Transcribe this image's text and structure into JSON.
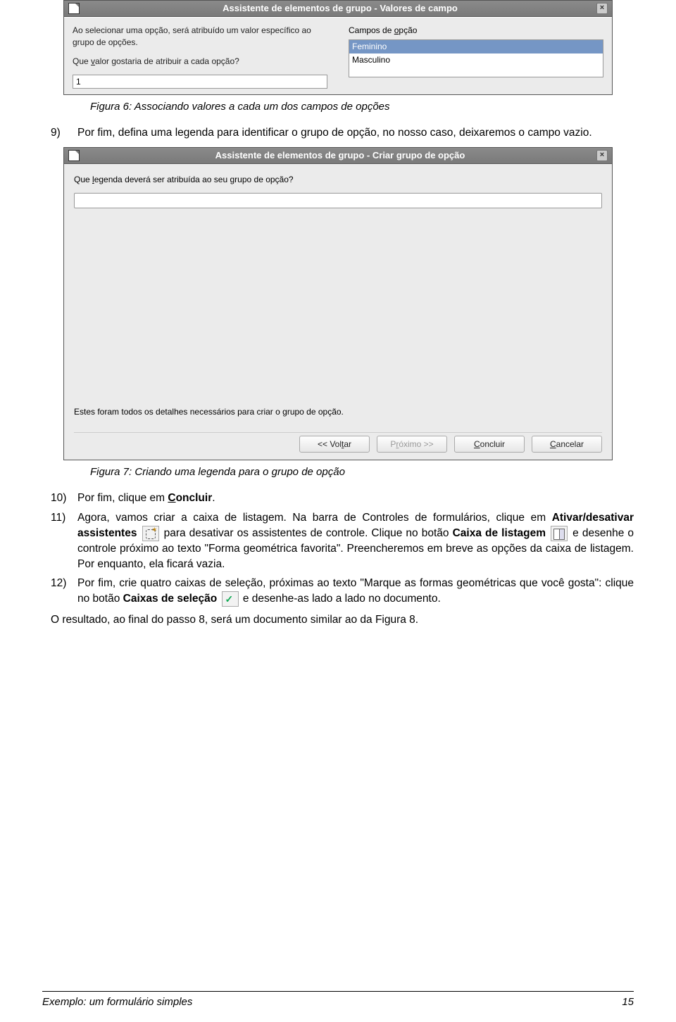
{
  "dialog1": {
    "title": "Assistente de elementos de grupo - Valores de campo",
    "left_p1": "Ao selecionar uma opção, será atribuído um valor específico ao grupo de opções.",
    "left_p2a": "Que ",
    "left_p2_accel": "v",
    "left_p2b": "alor gostaria de atribuir a cada opção?",
    "input_value": "1",
    "right_label_a": "Campos de ",
    "right_label_accel": "o",
    "right_label_b": "pção",
    "opt1": "Feminino",
    "opt2": "Masculino"
  },
  "caption1": "Figura 6: Associando valores a cada um dos campos de opções",
  "item9": {
    "num": "9)",
    "text": "Por fim, defina uma legenda para identificar o grupo de opção, no nosso caso, deixaremos o campo vazio."
  },
  "dialog2": {
    "title": "Assistente de elementos de grupo - Criar grupo de opção",
    "prompt_a": "Que ",
    "prompt_accel": "l",
    "prompt_b": "egenda deverá ser atribuída ao seu grupo de opção?",
    "summary": "Estes foram todos os detalhes necessários para criar o grupo de opção.",
    "btn_back_a": "<< Vol",
    "btn_back_accel": "t",
    "btn_back_b": "ar",
    "btn_next_a": "P",
    "btn_next_accel": "r",
    "btn_next_b": "óximo >>",
    "btn_finish_accel": "C",
    "btn_finish_b": "oncluir",
    "btn_cancel_accel": "C",
    "btn_cancel_b": "ancelar"
  },
  "caption2": "Figura 7: Criando uma legenda para o grupo de opção",
  "item10": {
    "num": "10)",
    "text_a": "Por fim, clique em ",
    "text_b_accel": "C",
    "text_b": "oncluir",
    "text_c": "."
  },
  "item11": {
    "num": "11)",
    "seg1": "Agora, vamos criar a caixa de listagem. Na barra de Controles de formulários, clique em ",
    "bold1": "Ativar/desativar assistentes",
    "seg2": " para desativar os assistentes de controle. Clique no botão ",
    "bold2": "Caixa de listagem",
    "seg3": " e desenhe o controle próximo ao texto \"Forma geométrica favorita\". Preencheremos em breve as opções da caixa de listagem. Por enquanto, ela ficará vazia."
  },
  "item12": {
    "num": "12)",
    "seg1": "Por fim, crie quatro caixas de seleção, próximas ao texto \"Marque as formas geométricas que você gosta\": clique no botão ",
    "bold1": "Caixas de seleção",
    "seg2": " e desenhe-as lado a lado no documento."
  },
  "result_para": "O resultado, ao final do passo 8, será um documento similar ao da Figura 8.",
  "footer_left": "Exemplo: um formulário simples",
  "footer_right": "15"
}
